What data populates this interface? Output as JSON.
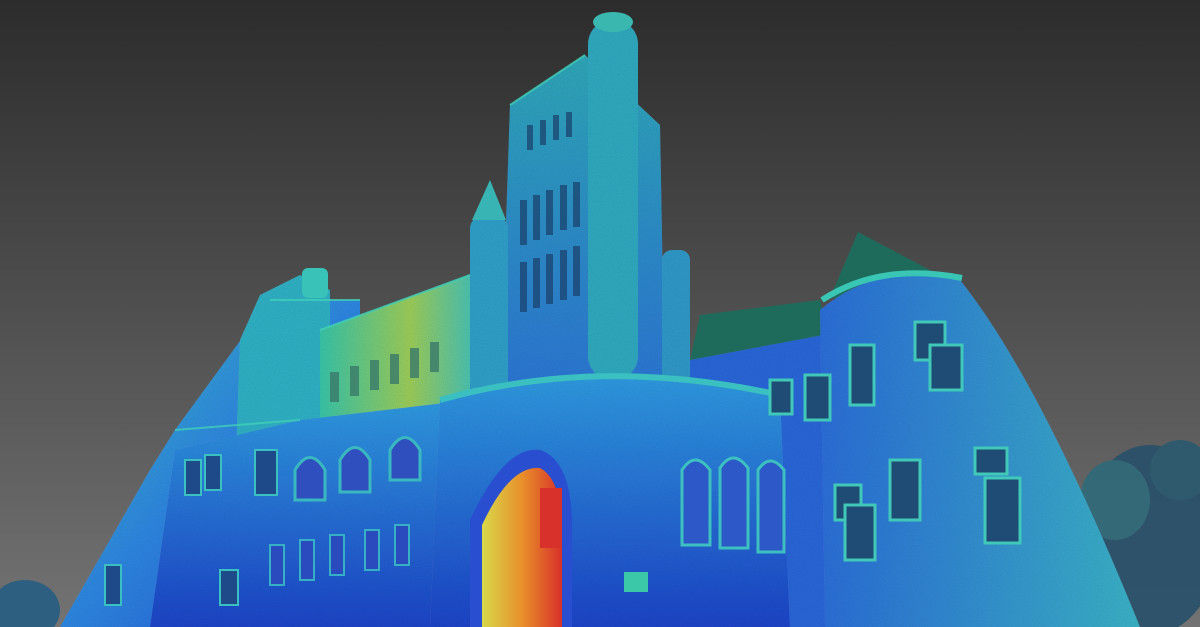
{
  "image": {
    "subject": "laser-scan-point-cloud",
    "colors": {
      "sky_top": "#2f2f2f",
      "sky_bottom": "#6e6e6e",
      "deep_blue": "#1f4fd6",
      "blue": "#2f7fe6",
      "cyan": "#33b8c8",
      "teal": "#2fa39a",
      "yellow": "#d8d84a",
      "orange": "#e8902a",
      "red": "#d8302a",
      "roof": "#1e6b5c",
      "window_dark": "#173a3a",
      "tree": "#2a4f6a"
    }
  }
}
